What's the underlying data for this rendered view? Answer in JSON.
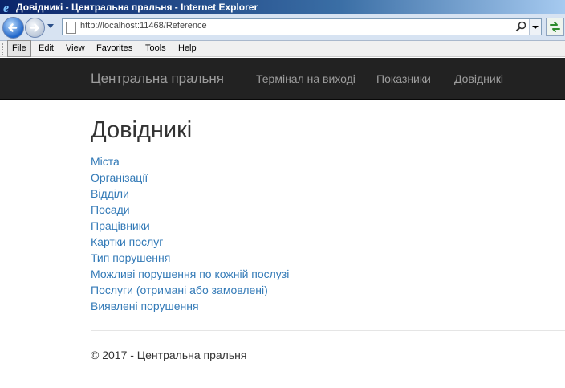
{
  "window": {
    "title": "Довідникі - Центральна пральня - Internet Explorer"
  },
  "toolbar": {
    "url_host": "http://localhost",
    "url_rest": ":11468/Reference"
  },
  "menu": {
    "items": [
      "File",
      "Edit",
      "View",
      "Favorites",
      "Tools",
      "Help"
    ]
  },
  "site": {
    "brand": "Центральна пральня",
    "nav": [
      "Термінал на виході",
      "Показники",
      "Довідникі"
    ]
  },
  "page": {
    "title": "Довідникі",
    "links": [
      "Міста",
      "Організації",
      "Відділи",
      "Посади",
      "Працівники",
      "Картки послуг",
      "Тип порушення",
      "Можливі порушення по кожній послузі",
      "Послуги (отримані або замовлені)",
      "Виявлені порушення"
    ]
  },
  "footer": {
    "text": "© 2017 - Центральна пральня"
  },
  "icons": [
    "ie-logo-icon",
    "back-arrow-icon",
    "forward-arrow-icon",
    "history-dropdown-icon",
    "page-icon",
    "search-icon",
    "address-dropdown-icon",
    "refresh-icon"
  ]
}
